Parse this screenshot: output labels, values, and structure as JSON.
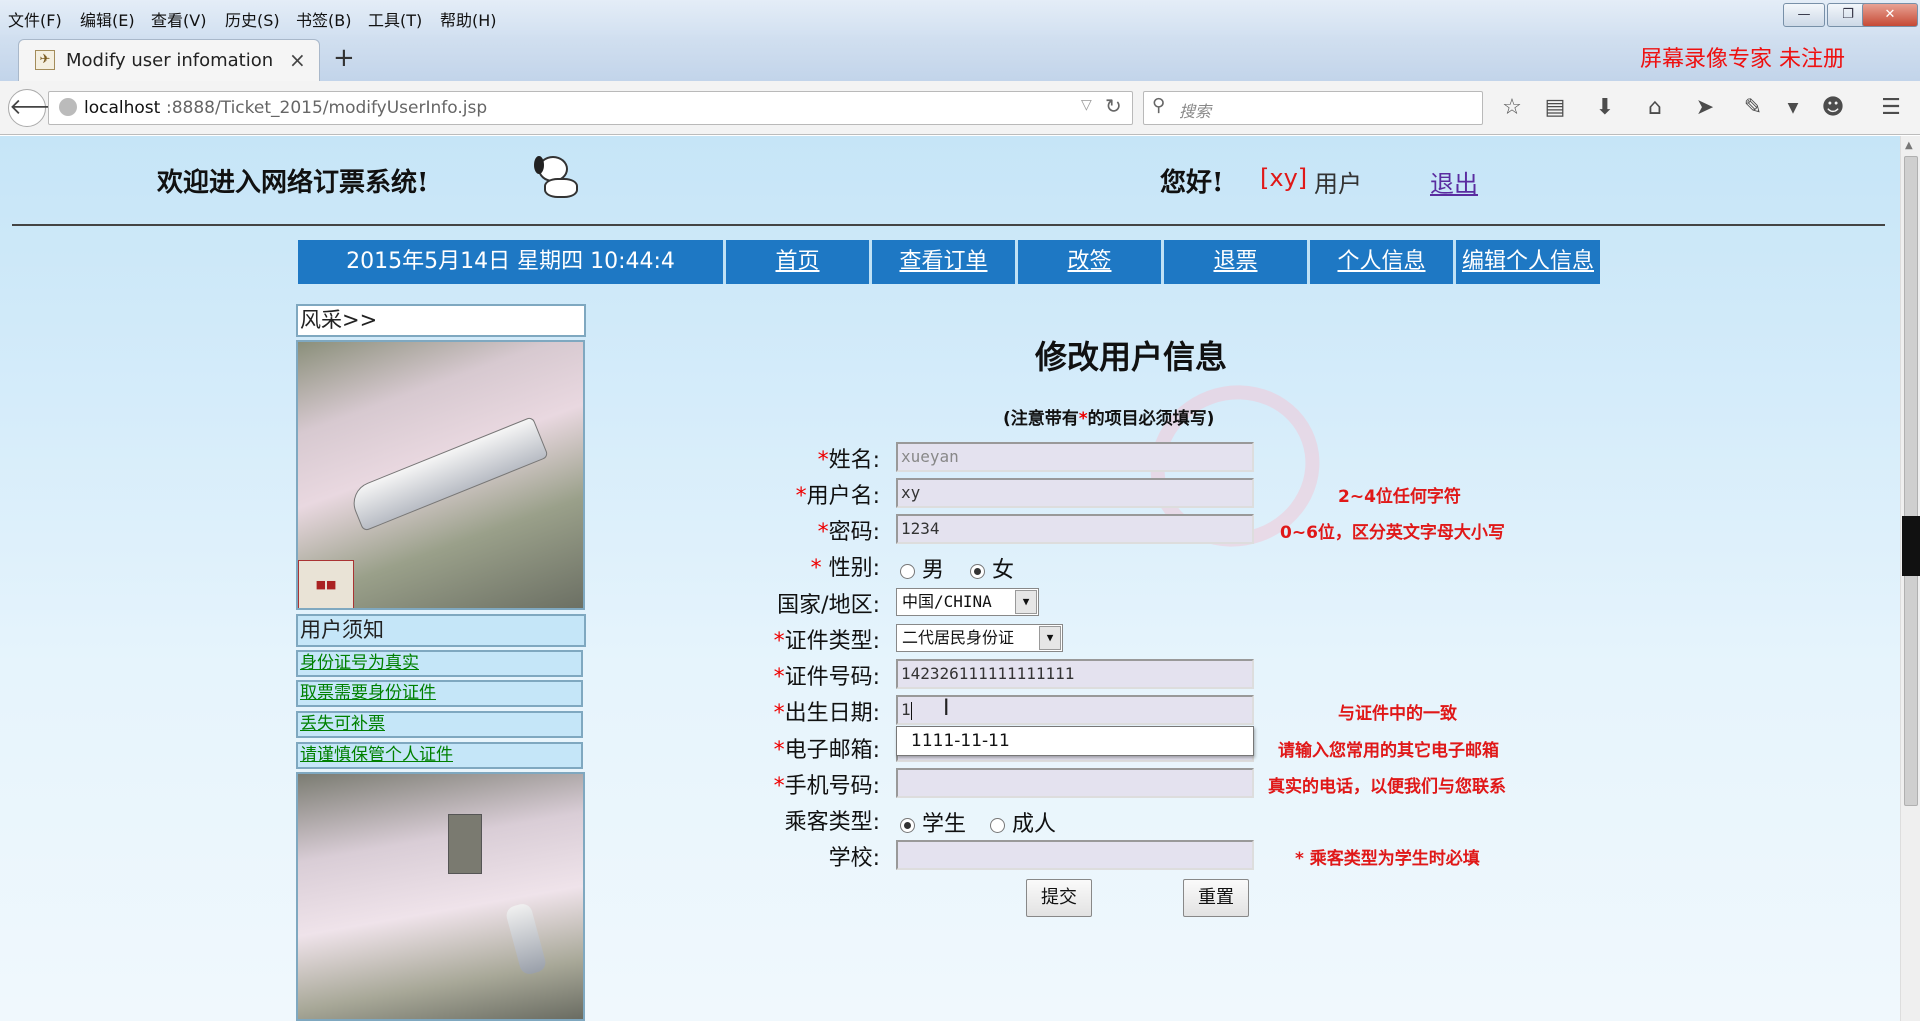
{
  "menu": {
    "file": "文件(F)",
    "edit": "编辑(E)",
    "view": "查看(V)",
    "history": "历史(S)",
    "bookmarks": "书签(B)",
    "tools": "工具(T)",
    "help": "帮助(H)"
  },
  "tab": {
    "title": "Modify user infomation",
    "close": "×",
    "new": "+"
  },
  "watermark": "屏幕录像专家  未注册",
  "address": {
    "host": "localhost",
    "rest": ":8888/Ticket_2015/modifyUserInfo.jsp"
  },
  "search": {
    "placeholder": "搜索"
  },
  "header": {
    "welcome": "欢迎进入网络订票系统!",
    "hello": "您好!",
    "user_tag": "[xy]",
    "user_suffix": "用户",
    "logout": "退出"
  },
  "nav": {
    "datetime": "2015年5月14日 星期四 10:44:4",
    "items": [
      "首页",
      "查看订单",
      "改签",
      "退票",
      "个人信息",
      "编辑个人信息"
    ]
  },
  "sidebar": {
    "gallery_title": "风采>>",
    "notice_title": "用户须知",
    "links": [
      "身份证号为真实",
      "取票需要身份证件",
      "丢失可补票",
      "请谨慎保管个人证件"
    ]
  },
  "form": {
    "title": "修改用户信息",
    "note_pre": "(注意带有",
    "note_star": "*",
    "note_post": "的项目必须填写)",
    "labels": {
      "name": "姓名:",
      "username": "用户名:",
      "password": "密码:",
      "gender": " 性别:",
      "country": "国家/地区:",
      "idtype": "证件类型:",
      "idnum": "证件号码:",
      "birth": "出生日期:",
      "email": "电子邮箱:",
      "phone": "手机号码:",
      "passenger": "乘客类型:",
      "school": "学校:"
    },
    "values": {
      "name": "xueyan",
      "username": "xy",
      "password": "1234",
      "country": "中国/CHINA",
      "idtype": "二代居民身份证",
      "idnum": "142326111111111111",
      "birth": "1",
      "email": "",
      "phone": "",
      "school": ""
    },
    "gender_options": [
      "男",
      "女"
    ],
    "passenger_options": [
      "学生",
      "成人"
    ],
    "autocomplete": "1111-11-11",
    "hints": {
      "username": "2~4位任何字符",
      "password": "0~6位，区分英文字母大小写",
      "birth": "与证件中的一致",
      "email": "请输入您常用的其它电子邮箱",
      "phone": "真实的电话，以便我们与您联系",
      "school": "*  乘客类型为学生时必填"
    },
    "submit": "提交",
    "reset": "重置"
  }
}
